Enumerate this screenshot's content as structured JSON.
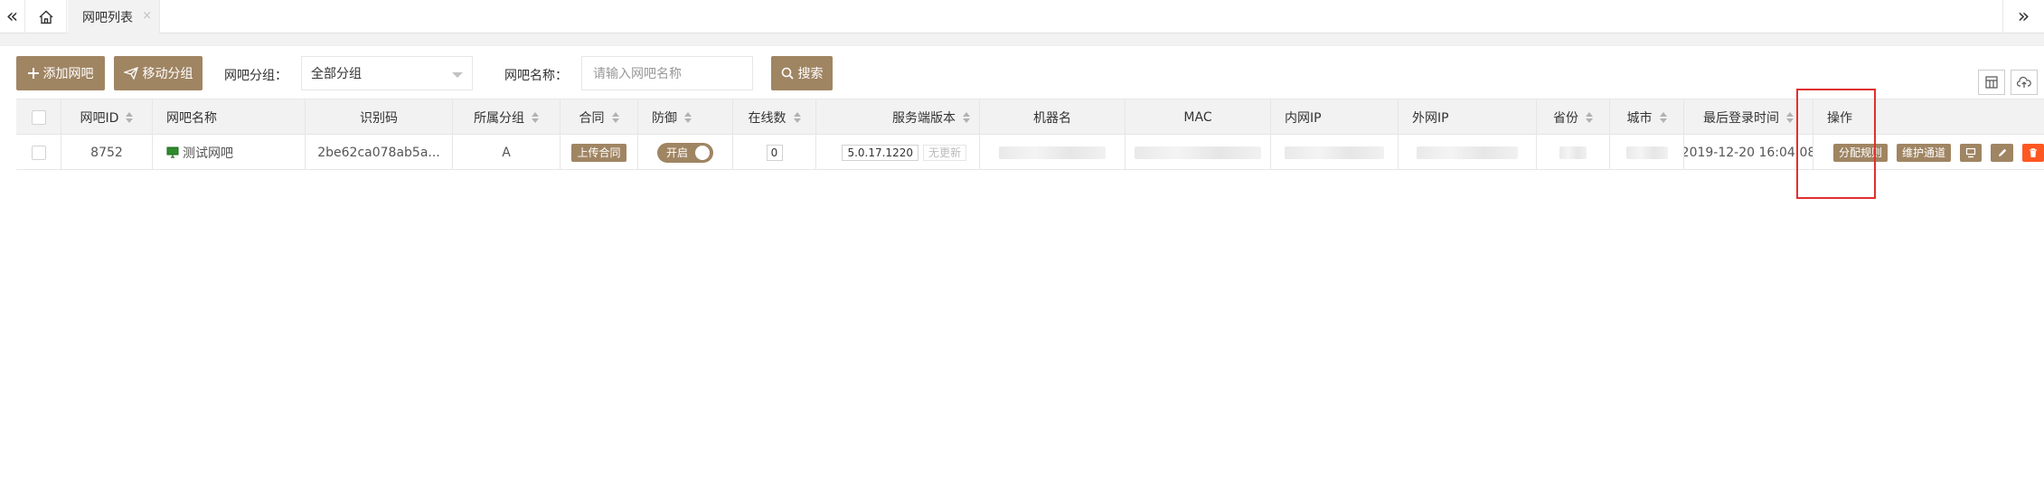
{
  "tabbar": {
    "active_tab_label": "网吧列表",
    "close_glyph": "×",
    "left_nav_glyph": "«",
    "right_nav_glyph": "»"
  },
  "toolbar": {
    "add_label": "添加网吧",
    "move_label": "移动分组",
    "group_label": "网吧分组：",
    "group_selected": "全部分组",
    "name_label": "网吧名称：",
    "name_placeholder": "请输入网吧名称",
    "search_label": "搜索"
  },
  "table": {
    "headers": {
      "id": "网吧ID",
      "name": "网吧名称",
      "code": "识别码",
      "group": "所属分组",
      "contract": "合同",
      "defense": "防御",
      "online": "在线数",
      "version": "服务端版本",
      "machine": "机器名",
      "mac": "MAC",
      "lan_ip": "内网IP",
      "wan_ip": "外网IP",
      "province": "省份",
      "city": "城市",
      "last_login": "最后登录时间",
      "ops": "操作"
    },
    "row": {
      "id": "8752",
      "name": "测试网吧",
      "code": "2be62ca078ab5a...",
      "group": "A",
      "contract_btn": "上传合同",
      "defense_state": "开启",
      "online": "0",
      "version": "5.0.17.1220",
      "version_note": "无更新",
      "last_login": "2019-12-20 16:04:08",
      "op_assign_rule": "分配规则",
      "op_maintain": "维护通道"
    }
  },
  "colors": {
    "accent": "#a08563",
    "danger": "#ff5722",
    "highlight": "#e03030"
  }
}
